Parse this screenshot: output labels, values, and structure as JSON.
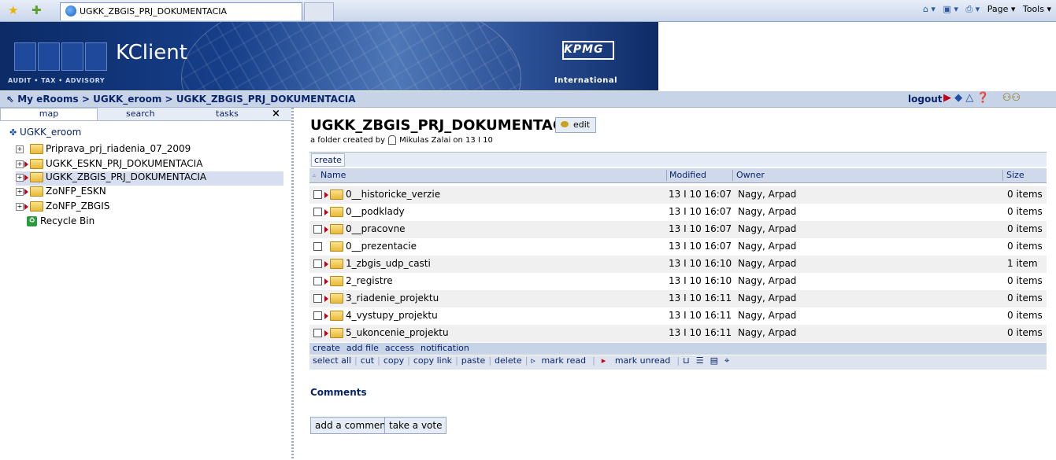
{
  "browser": {
    "tab_title": "UGKK_ZBGIS_PRJ_DOKUMENTACIA",
    "page_menu": "Page ▾",
    "tools_menu": "Tools ▾"
  },
  "header": {
    "brand": "KClient",
    "tagline": "AUDIT • TAX • ADVISORY",
    "logo": "KPMG",
    "logo_sub": "International"
  },
  "breadcrumb": "My eRooms > UGKK_eroom > UGKK_ZBGIS_PRJ_DOKUMENTACIA",
  "logout": "logout",
  "left_tabs": {
    "map": "map",
    "search": "search",
    "tasks": "tasks",
    "close": "×"
  },
  "tree": {
    "root": "UGKK_eroom",
    "items": [
      {
        "label": "Priprava_prj_riadenia_07_2009"
      },
      {
        "label": "UGKK_ESKN_PRJ_DOKUMENTACIA"
      },
      {
        "label": "UGKK_ZBGIS_PRJ_DOKUMENTACIA"
      },
      {
        "label": "ZoNFP_ESKN"
      },
      {
        "label": "ZoNFP_ZBGIS"
      },
      {
        "label": "Recycle Bin"
      }
    ]
  },
  "folder": {
    "title": "UGKK_ZBGIS_PRJ_DOKUMENTACIA",
    "edit_label": "edit",
    "created_prefix": "a folder created by",
    "created_suffix": "Mikulas Zalai on 13 I 10"
  },
  "create_label": "create",
  "table": {
    "headers": {
      "name": "Name",
      "modified": "Modified",
      "owner": "Owner",
      "size": "Size"
    },
    "rows": [
      {
        "name": "0__historicke_verzie",
        "modified": "13 I 10 16:07",
        "owner": "Nagy, Arpad",
        "size": "0 items"
      },
      {
        "name": "0__podklady",
        "modified": "13 I 10 16:07",
        "owner": "Nagy, Arpad",
        "size": "0 items"
      },
      {
        "name": "0__pracovne",
        "modified": "13 I 10 16:07",
        "owner": "Nagy, Arpad",
        "size": "0 items"
      },
      {
        "name": "0__prezentacie",
        "modified": "13 I 10 16:07",
        "owner": "Nagy, Arpad",
        "size": "0 items"
      },
      {
        "name": "1_zbgis_udp_casti",
        "modified": "13 I 10 16:10",
        "owner": "Nagy, Arpad",
        "size": "1 item"
      },
      {
        "name": "2_registre",
        "modified": "13 I 10 16:10",
        "owner": "Nagy, Arpad",
        "size": "0 items"
      },
      {
        "name": "3_riadenie_projektu",
        "modified": "13 I 10 16:11",
        "owner": "Nagy, Arpad",
        "size": "0 items"
      },
      {
        "name": "4_vystupy_projektu",
        "modified": "13 I 10 16:11",
        "owner": "Nagy, Arpad",
        "size": "0 items"
      },
      {
        "name": "5_ukoncenie_projektu",
        "modified": "13 I 10 16:11",
        "owner": "Nagy, Arpad",
        "size": "0 items"
      }
    ]
  },
  "actions": {
    "create": "create",
    "add_file": "add file",
    "access": "access",
    "notification": "notification"
  },
  "toolbar": {
    "select_all": "select all",
    "cut": "cut",
    "copy": "copy",
    "copy_link": "copy link",
    "paste": "paste",
    "delete": "delete",
    "mark_read": "mark read",
    "mark_unread": "mark unread"
  },
  "comments": {
    "heading": "Comments",
    "add_comment": "add a comment",
    "take_vote": "take a vote"
  }
}
